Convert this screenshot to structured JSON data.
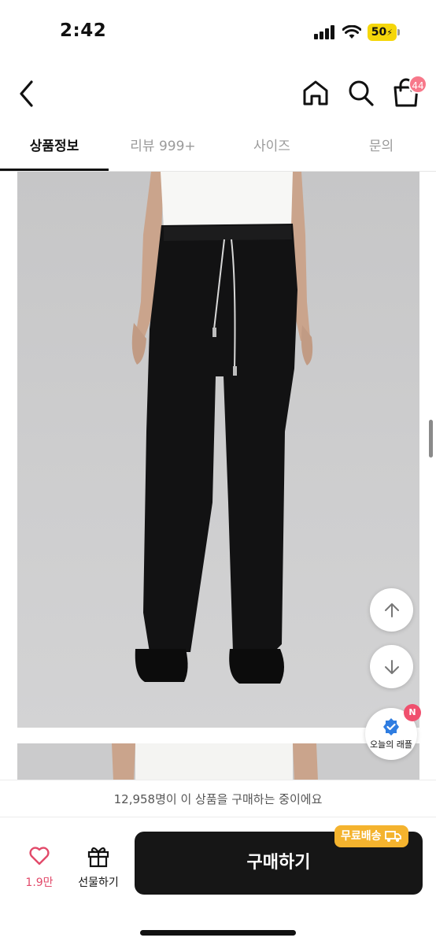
{
  "status_bar": {
    "time": "2:42",
    "battery": "50"
  },
  "nav": {
    "cart_count": "44"
  },
  "tabs": [
    {
      "label": "상품정보",
      "active": true
    },
    {
      "label": "리뷰 999+",
      "active": false
    },
    {
      "label": "사이즈",
      "active": false
    },
    {
      "label": "문의",
      "active": false
    }
  ],
  "raffle": {
    "label": "오늘의 래플",
    "badge": "N"
  },
  "buyer_banner": "12,958명이 이 상품을 구매하는 중이에요",
  "bottom": {
    "like_count": "1.9만",
    "gift_label": "선물하기",
    "buy_label": "구매하기",
    "free_shipping": "무료배송"
  },
  "colors": {
    "accent_pink": "#e24a6a",
    "badge_pink": "#f7788a",
    "shipping_yellow": "#f4b32e",
    "buy_button": "#161616"
  },
  "icons": [
    "back-icon",
    "home-icon",
    "search-icon",
    "shopping-bag-icon",
    "arrow-up-icon",
    "arrow-down-icon",
    "verified-icon",
    "heart-icon",
    "gift-icon",
    "truck-icon"
  ]
}
